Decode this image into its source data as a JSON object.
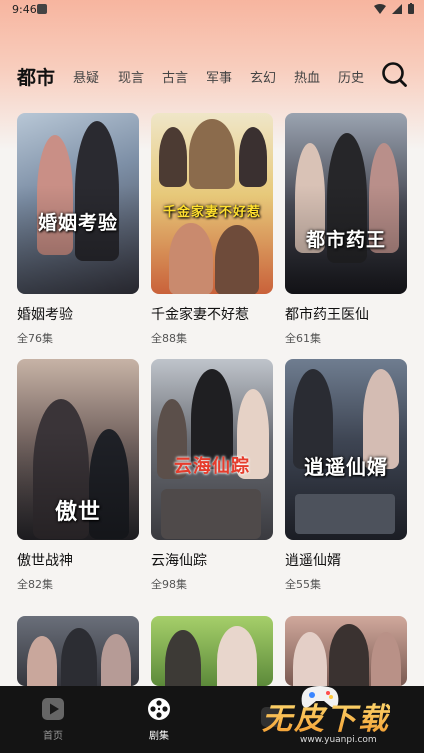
{
  "status_bar": {
    "time": "9:46"
  },
  "categories": {
    "active": "都市",
    "items": [
      "悬疑",
      "现言",
      "古言",
      "军事",
      "玄幻",
      "热血",
      "历史"
    ]
  },
  "dramas": [
    {
      "poster_title": "婚姻考验",
      "title": "婚姻考验",
      "episodes": "全76集"
    },
    {
      "poster_title": "千金家妻不好惹",
      "title": "千金家妻不好惹",
      "episodes": "全88集"
    },
    {
      "poster_title": "都市药王",
      "title": "都市药王医仙",
      "episodes": "全61集"
    },
    {
      "poster_title": "傲世",
      "title": "傲世战神",
      "episodes": "全82集"
    },
    {
      "poster_title": "云海仙踪",
      "title": "云海仙踪",
      "episodes": "全98集"
    },
    {
      "poster_title": "逍遥仙婿",
      "title": "逍遥仙婿",
      "episodes": "全55集"
    },
    {
      "poster_title": "",
      "title": "",
      "episodes": ""
    },
    {
      "poster_title": "",
      "title": "",
      "episodes": ""
    },
    {
      "poster_title": "",
      "title": "",
      "episodes": ""
    }
  ],
  "bottom_nav": {
    "home": "首页",
    "series": "剧集",
    "third": ""
  },
  "watermark": {
    "brand": "无皮下载",
    "url": "www.yuanpi.com"
  },
  "colors": {
    "accent_bg": "#f7b59f",
    "nav_bg": "#141414"
  }
}
